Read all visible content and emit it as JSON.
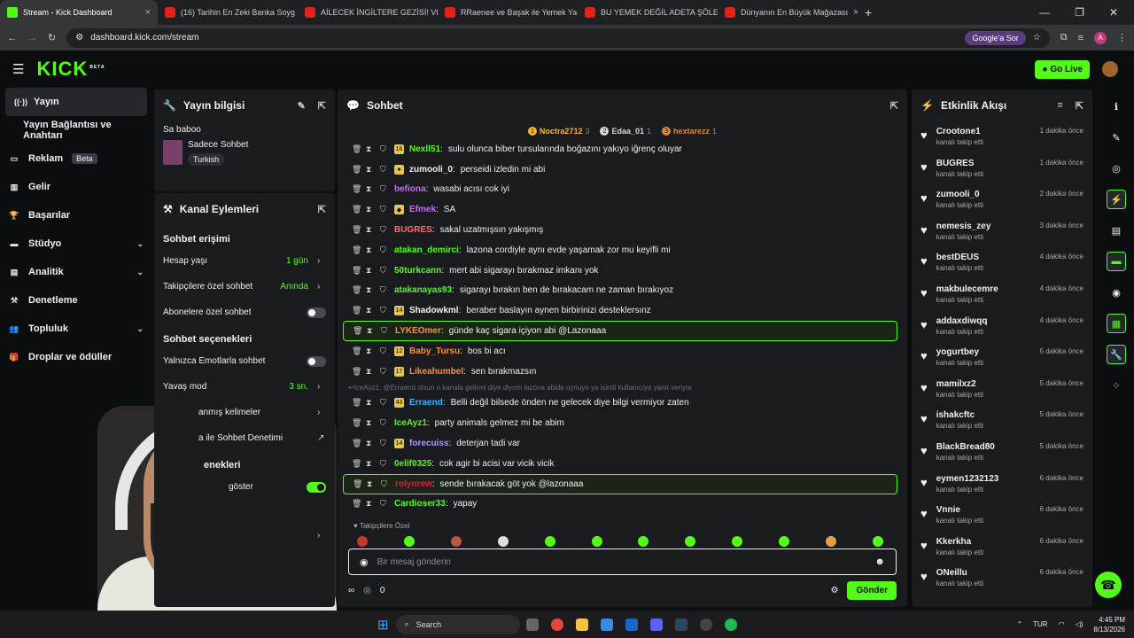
{
  "browser": {
    "tabs": [
      {
        "label": "Stream - Kick Dashboard",
        "active": true,
        "type": "kick"
      },
      {
        "label": "(16) Tarihin En Zeki Banka Soyg",
        "type": "yt"
      },
      {
        "label": "AİLECEK İNGİLTERE GEZİSİ! VLO",
        "type": "yt"
      },
      {
        "label": "RRaenee ve Başak ile Yemek Ya",
        "type": "yt"
      },
      {
        "label": "BU YEMEK DEĞİL ADETA ŞÖLEN",
        "type": "yt"
      },
      {
        "label": "Dünyanın En Büyük Mağazası",
        "type": "yt"
      }
    ],
    "url": "dashboard.kick.com/stream",
    "google_sor": "Google'a Sor",
    "profile_initial": "A"
  },
  "header": {
    "logo": "KICK",
    "logo_sup": "BETA",
    "go_live": "Go Live"
  },
  "sidenav": {
    "items": [
      {
        "label": "Yayın",
        "icon": "broadcast-icon",
        "active": true
      },
      {
        "label": "Yayın Bağlantısı ve Anahtarı",
        "sub": true
      },
      {
        "label": "Reklam",
        "icon": "ad-icon",
        "badge": "Beta"
      },
      {
        "label": "Gelir",
        "icon": "chart-icon"
      },
      {
        "label": "Başarılar",
        "icon": "trophy-icon"
      },
      {
        "label": "Stüdyo",
        "icon": "studio-icon",
        "chevron": true
      },
      {
        "label": "Analitik",
        "icon": "analytics-icon",
        "chevron": true
      },
      {
        "label": "Denetleme",
        "icon": "hammer-icon"
      },
      {
        "label": "Topluluk",
        "icon": "people-icon",
        "chevron": true
      },
      {
        "label": "Droplar ve ödüller",
        "icon": "gift-icon"
      }
    ]
  },
  "stream_info": {
    "title": "Yayın bilgisi",
    "stream_title": "Sa baboo",
    "chat_mode": "Sadece Sohbet",
    "language": "Turkish"
  },
  "channel_actions": {
    "title": "Kanal Eylemleri",
    "chat_access": "Sohbet erişimi",
    "account_age": {
      "label": "Hesap yaşı",
      "value": "1 gün"
    },
    "followers_only": {
      "label": "Takipçilere özel sohbet",
      "value": "Anında"
    },
    "subscribers_only": {
      "label": "Abonelere özel sohbet"
    },
    "chat_options": "Sohbet seçenekleri",
    "emote_only": {
      "label": "Yalnızca Emotlarla sohbet"
    },
    "slow_mode": {
      "label": "Yavaş mod",
      "value": "3 sn."
    },
    "banned_words": "anmış kelimeler",
    "ai_moderation": "a ile Sohbet Denetimi",
    "section3": "enekleri",
    "show": "göster"
  },
  "chat": {
    "title": "Sohbet",
    "pinned": [
      {
        "rank": "1",
        "name": "Noctra2712",
        "count": "3",
        "color": "#f5b82e"
      },
      {
        "rank": "2",
        "name": "Edaa_01",
        "count": "1",
        "color": "#d9d9d9"
      },
      {
        "rank": "3",
        "name": "hextarezz",
        "count": "1",
        "color": "#d9893d"
      }
    ],
    "messages": [
      {
        "user": "Nexll51",
        "text": "sulu olunca biber tursularında boğazını yakıyo iğrenç oluyar",
        "color": "#53fc18",
        "badge": "16"
      },
      {
        "user": "zumooli_0",
        "text": "perseidi izledin mi abi",
        "color": "#eef0f1",
        "badge": "●"
      },
      {
        "user": "befiona",
        "text": "wasabi acısı cok iyi",
        "color": "#c46bff"
      },
      {
        "user": "Efmek",
        "text": "SA",
        "color": "#c46bff",
        "badge": "◆"
      },
      {
        "user": "BUGRES",
        "text": "sakal uzatmışsın yakışmış",
        "color": "#ff6b6b"
      },
      {
        "user": "atakan_demirci",
        "text": "lazona cordiyle aynı evde yaşamak zor mu keyifli mi",
        "color": "#53fc18"
      },
      {
        "user": "50turkcann",
        "text": "mert abi sigarayı bırakmaz imkanı yok",
        "color": "#53fc18"
      },
      {
        "user": "atakanayas93",
        "text": "sigarayı bırakın ben de bırakacam ne zaman bırakıyoz",
        "color": "#53fc18"
      },
      {
        "user": "Shadowkml",
        "text": "beraber baslayın aynen birbirinizi desteklersınz",
        "color": "#eef0f1",
        "badge": "14"
      },
      {
        "user": "LYKEOmer",
        "text": "günde kaç sigara içiyon abi @Lazonaaa",
        "color": "#ff8c3a",
        "highlight": true
      },
      {
        "user": "Baby_Tursu",
        "text": "bos bi acı",
        "color": "#ff8c3a",
        "badge": "12"
      },
      {
        "user": "Likeahumbel",
        "text": "sen bırakmazsın",
        "color": "#ff8c3a",
        "badge": "17"
      }
    ],
    "reply_line": "IceAyz1: @Erraend olsun o kanala gelirmi diye diyom lazona abide oynuyo ya isimli kullanıcıya yanıt veriyor",
    "messages2": [
      {
        "user": "Erraend",
        "text": "Belli değil bilsede önden ne gelecek diye bilgi vermiyor zaten",
        "color": "#2eb6ff",
        "badge": "43"
      },
      {
        "user": "IceAyz1",
        "text": "party animals gelmez mi be abim",
        "color": "#53fc18"
      },
      {
        "user": "forecuiss",
        "text": "deterjan tadi var",
        "color": "#a99cff",
        "badge": "14"
      },
      {
        "user": "0elif0325",
        "text": "cok agir bi acisi var vicik vicik",
        "color": "#53fc18"
      },
      {
        "user": "rolynrew",
        "text": "sende bırakacak göt yok @lazonaaa",
        "color": "#e0184f",
        "highlight": true
      },
      {
        "user": "Cardioser33",
        "text": "yapay",
        "color": "#53fc18"
      }
    ],
    "followers_label": "Takipçilere Özel",
    "input_placeholder": "Bir mesaj gönderin",
    "points": "0",
    "send": "Gönder"
  },
  "activity": {
    "title": "Etkinlik Akışı",
    "sub_text": "kanalı takip etti",
    "items": [
      {
        "name": "Crootone1",
        "time": "1 dakika önce"
      },
      {
        "name": "BUGRES",
        "time": "1 dakika önce"
      },
      {
        "name": "zumooli_0",
        "time": "2 dakika önce"
      },
      {
        "name": "nemesis_zey",
        "time": "3 dakika önce"
      },
      {
        "name": "bestDEUS",
        "time": "4 dakika önce"
      },
      {
        "name": "makbulecemre",
        "time": "4 dakika önce"
      },
      {
        "name": "addaxdiwqq",
        "time": "4 dakika önce"
      },
      {
        "name": "yogurtbey",
        "time": "5 dakika önce"
      },
      {
        "name": "mamilxz2",
        "time": "5 dakika önce"
      },
      {
        "name": "ishakcftc",
        "time": "5 dakika önce"
      },
      {
        "name": "BlackBread80",
        "time": "5 dakika önce"
      },
      {
        "name": "eymen1232123",
        "time": "6 dakika önce"
      },
      {
        "name": "Vnnie",
        "time": "6 dakika önce"
      },
      {
        "name": "Kkerkha",
        "time": "6 dakika önce"
      },
      {
        "name": "ONeillu",
        "time": "6 dakika önce"
      }
    ]
  },
  "taskbar": {
    "search": "Search",
    "lang": "TUR",
    "time": "4:45 PM",
    "date": "8/13/2026"
  },
  "colors": {
    "accent": "#53fc18",
    "panel": "#191b1f",
    "bg": "#0b0e0f"
  }
}
